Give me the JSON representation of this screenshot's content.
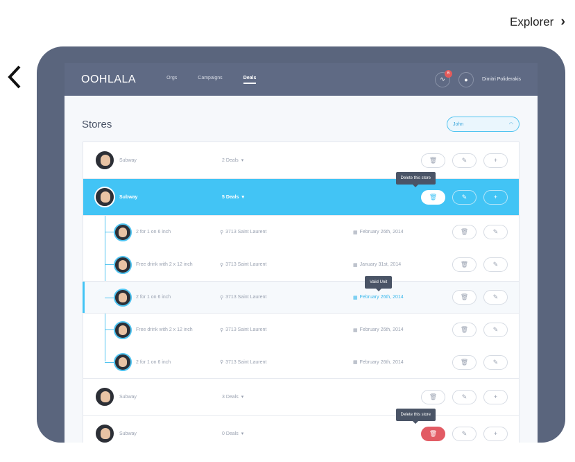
{
  "top": {
    "explorer_label": "Explorer"
  },
  "navbar": {
    "brand": "OOHLALA",
    "links": [
      "Orgs",
      "Campaigns",
      "Deals"
    ],
    "notification_count": "6",
    "user_name": "Dimitri Poliderakis"
  },
  "page": {
    "title": "Stores"
  },
  "search": {
    "value": "John"
  },
  "stores": [
    {
      "name": "Subway",
      "deals": "2 Deals"
    },
    {
      "name": "Subway",
      "deals": "5 Deals"
    },
    {
      "name": "Subway",
      "deals": "3 Deals"
    },
    {
      "name": "Subway",
      "deals": "0 Deals"
    }
  ],
  "deals": [
    {
      "title": "2 for 1 on 6 inch",
      "location": "3713 Saint Laurent",
      "date": "February 26th, 2014"
    },
    {
      "title": "Free drink with 2 x 12 inch",
      "location": "3713 Saint Laurent",
      "date": "January 31st, 2014"
    },
    {
      "title": "2 for 1 on 6 inch",
      "location": "3713 Saint Laurent",
      "date": "February 26th, 2014"
    },
    {
      "title": "Free drink with 2 x 12 inch",
      "location": "3713 Saint Laurent",
      "date": "February 26th, 2014"
    },
    {
      "title": "2 for 1 on 6 inch",
      "location": "3713 Saint Laurent",
      "date": "February 26th, 2014"
    }
  ],
  "tooltips": {
    "delete_store": "Delete this store",
    "valid_unit": "Valid Unit"
  },
  "colors": {
    "accent": "#42c4f5",
    "danger": "#e25b64",
    "nav": "#5f6a84",
    "device": "#5a657d"
  },
  "icons": {
    "trash": "trash-icon",
    "edit": "edit-icon",
    "add": "plus-icon",
    "pin": "pin-icon",
    "calendar": "calendar-icon"
  }
}
